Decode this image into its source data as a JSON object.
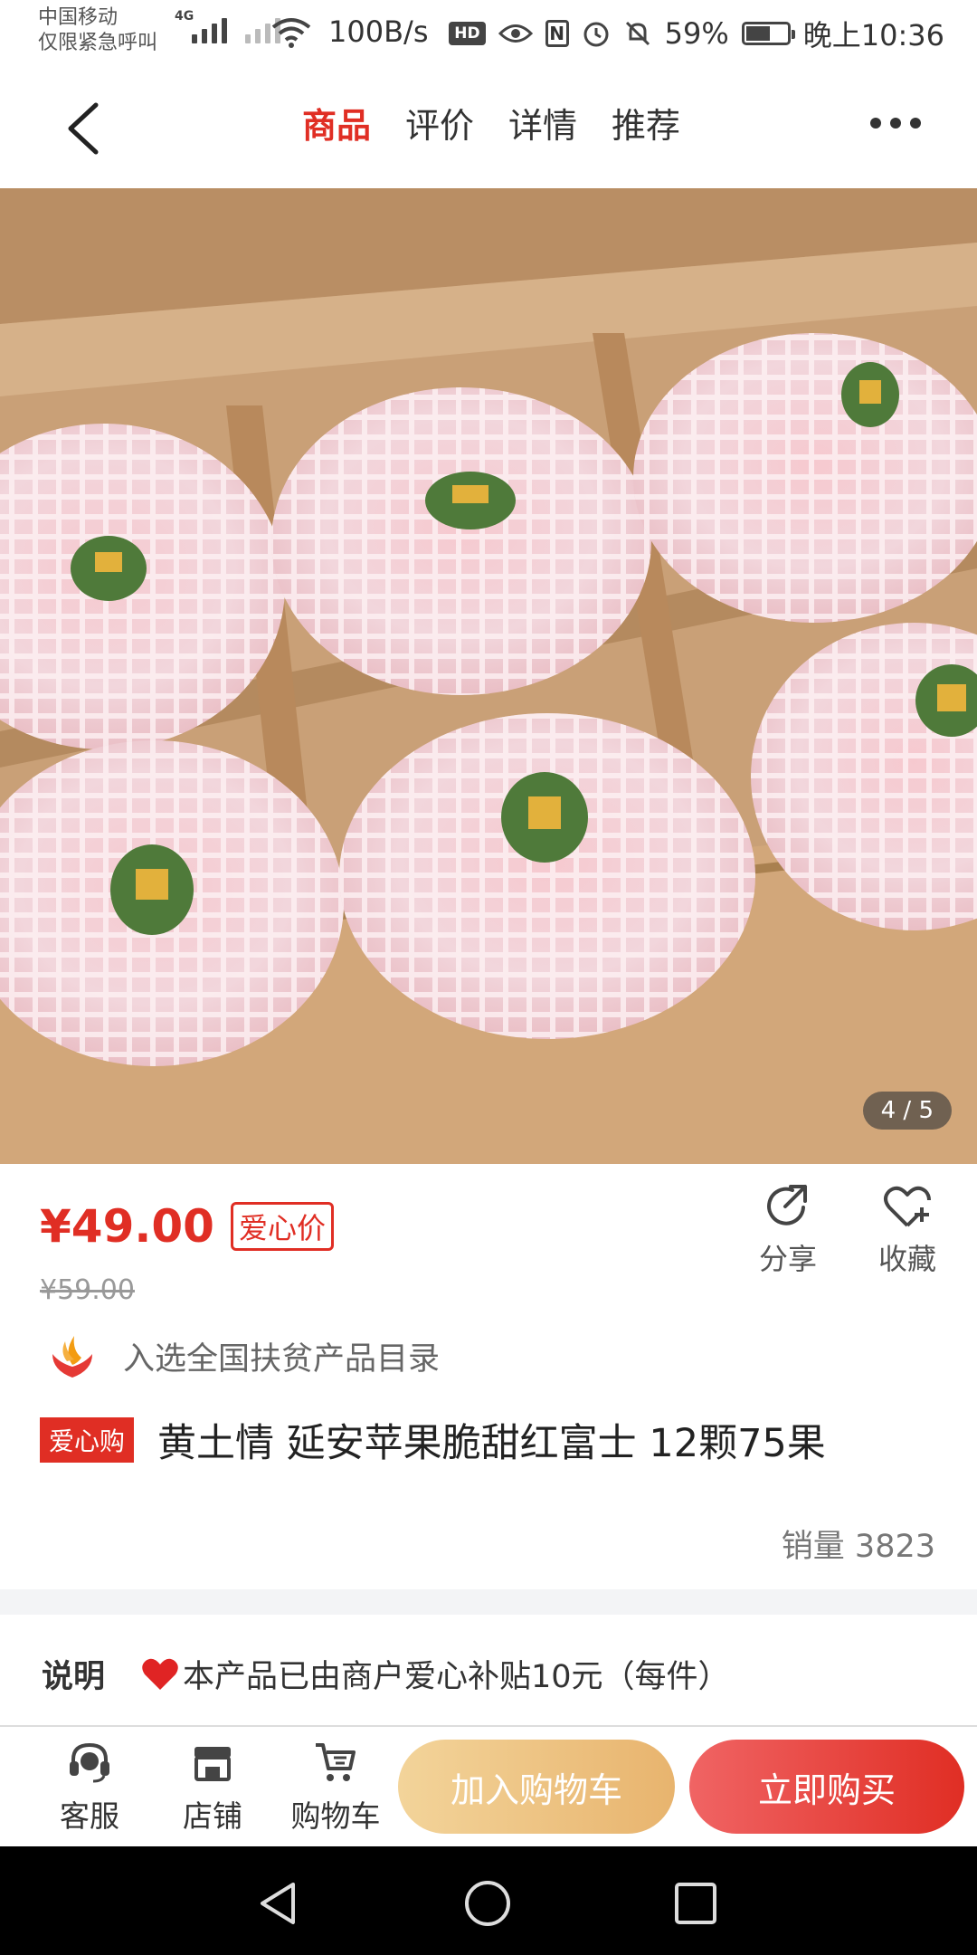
{
  "status_bar": {
    "carrier_line1": "中国移动",
    "carrier_line2": "仅限紧急呼叫",
    "network": "4G",
    "speed": "100B/s",
    "hd": "HD",
    "nfc": "N",
    "battery": "59%",
    "battery_level": 0.59,
    "time": "晚上10:36"
  },
  "nav": {
    "tabs": [
      {
        "label": "商品",
        "active": true
      },
      {
        "label": "评价",
        "active": false
      },
      {
        "label": "详情",
        "active": false
      },
      {
        "label": "推荐",
        "active": false
      }
    ]
  },
  "hero": {
    "counter": "4 / 5",
    "description_icon": "apples-in-box-image"
  },
  "product": {
    "price": "¥49.00",
    "price_tag": "爱心价",
    "original_price": "¥59.00",
    "share_label": "分享",
    "favorite_label": "收藏",
    "poverty_text": "入选全国扶贫产品目录",
    "badge": "爱心购",
    "title": "黄土情 延安苹果脆甜红富士 12颗75果",
    "sales": "销量 3823"
  },
  "description": {
    "label": "说明",
    "text": "本产品已由商户爱心补贴10元（每件）"
  },
  "bottom_bar": {
    "service_label": "客服",
    "shop_label": "店铺",
    "cart_label": "购物车",
    "add_to_cart": "加入购物车",
    "buy_now": "立即购买"
  },
  "colors": {
    "accent": "#e02e24",
    "cart_button": "#e8b46e",
    "buy_button": "#e02e24"
  }
}
